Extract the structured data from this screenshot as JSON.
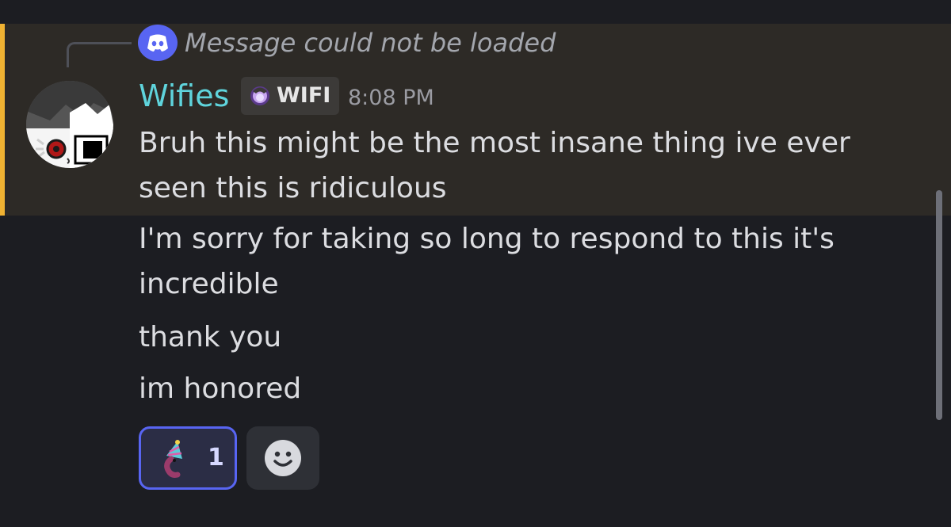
{
  "reply": {
    "icon": "discord-icon",
    "text": "Message could not be loaded"
  },
  "message": {
    "author": "Wifies",
    "author_color": "#5fd4dc",
    "tag_label": "WIFI",
    "timestamp": "8:08 PM",
    "highlight_color": "#f0b232",
    "lines": [
      "Bruh this might be the most insane thing ive ever",
      "seen this is ridiculous",
      "I'm sorry for taking so long to respond to this it's",
      "incredible",
      "thank you",
      "im honored"
    ]
  },
  "reactions": [
    {
      "emoji": "party-hat-worm-emoji",
      "count": "1"
    }
  ],
  "add_reaction_icon": "smiley-icon",
  "accent_color": "#5865f2"
}
